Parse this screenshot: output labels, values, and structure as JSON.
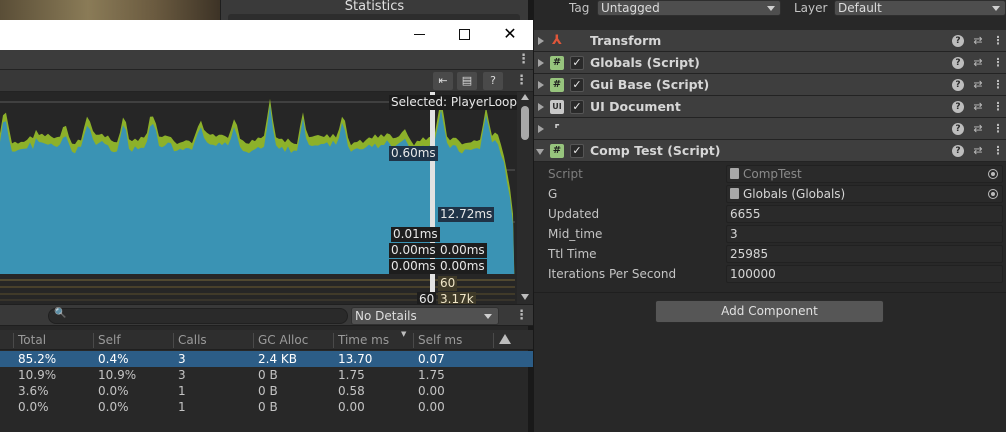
{
  "stats_title": "Statistics",
  "profiler": {
    "selected_label": "Selected: PlayerLoop",
    "chart_labels": {
      "a": "0.60ms",
      "b": "12.72ms",
      "c": "0.01ms",
      "d": "0.00ms",
      "e": "0.00ms",
      "f": "0.00ms",
      "g": "0.00ms",
      "h": "60",
      "i": "60",
      "j": "3.17k"
    },
    "details_dropdown": "No Details",
    "search_placeholder": "",
    "columns": [
      "Total",
      "Self",
      "Calls",
      "GC Alloc",
      "Time ms",
      "Self ms"
    ],
    "rows": [
      [
        "85.2%",
        "0.4%",
        "3",
        "2.4 KB",
        "13.70",
        "0.07"
      ],
      [
        "10.9%",
        "10.9%",
        "3",
        "0 B",
        "1.75",
        "1.75"
      ],
      [
        "3.6%",
        "0.0%",
        "1",
        "0 B",
        "0.58",
        "0.00"
      ],
      [
        "0.0%",
        "0.0%",
        "1",
        "0 B",
        "0.00",
        "0.00"
      ]
    ],
    "colors": {
      "cpu_blue": "#3a93b4",
      "cpu_green": "#8db12a",
      "selected_row": "#2c5d87"
    }
  },
  "inspector": {
    "tag_label": "Tag",
    "tag_value": "Untagged",
    "layer_label": "Layer",
    "layer_value": "Default",
    "components": [
      {
        "name": "Transform"
      },
      {
        "name": "Globals (Script)"
      },
      {
        "name": "Gui Base (Script)"
      },
      {
        "name": "UI Document"
      },
      {
        "name": ""
      },
      {
        "name": "Comp Test (Script)"
      }
    ],
    "properties": [
      {
        "label": "Script",
        "value": "CompTest"
      },
      {
        "label": "G",
        "value": "Globals (Globals)"
      },
      {
        "label": "Updated",
        "value": "6655"
      },
      {
        "label": "Mid_time",
        "value": "3"
      },
      {
        "label": "Ttl Time",
        "value": "25985"
      },
      {
        "label": "Iterations Per Second",
        "value": "100000"
      }
    ],
    "add_component": "Add Component"
  }
}
